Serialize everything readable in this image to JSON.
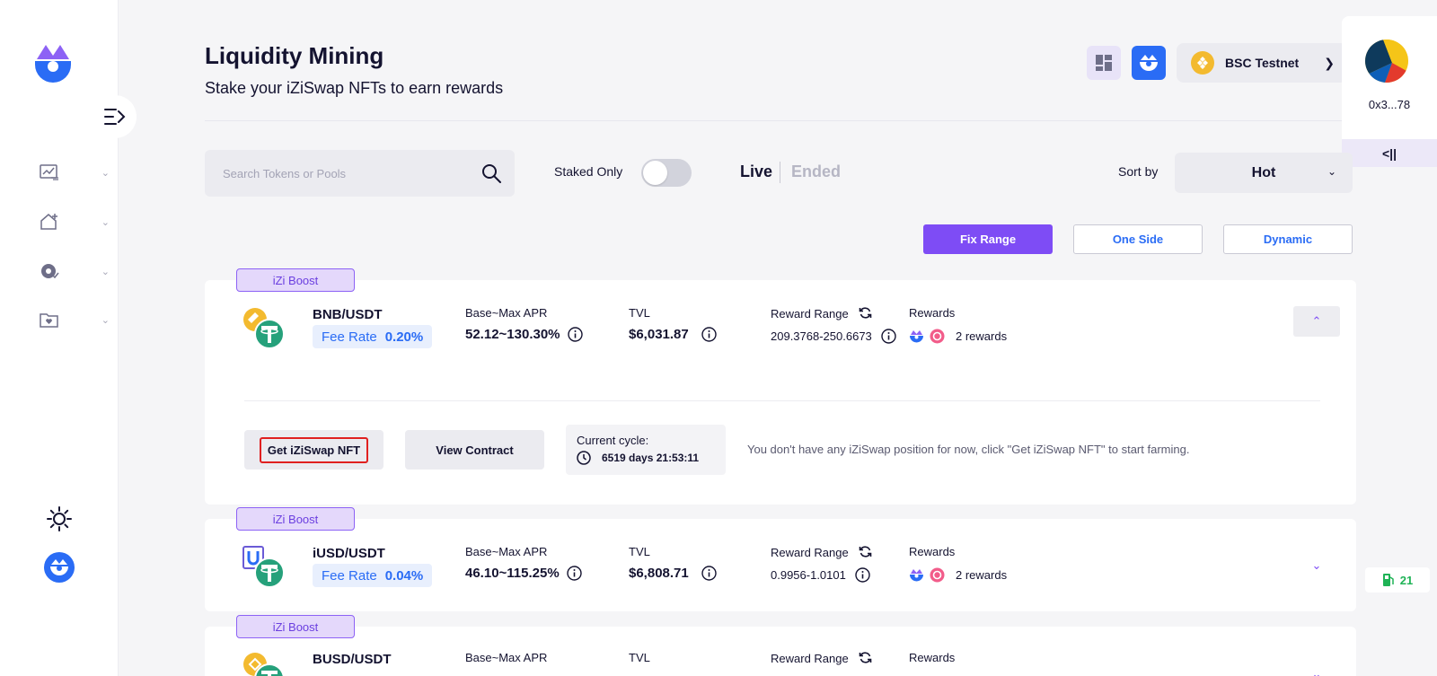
{
  "header": {
    "title": "Liquidity Mining",
    "subtitle": "Stake your iZiSwap NFTs to earn rewards"
  },
  "topbar": {
    "network_label": "BSC Testnet"
  },
  "account": {
    "address": "0x3...78",
    "panel_toggle": "<||"
  },
  "filters": {
    "search_placeholder": "Search Tokens or Pools",
    "staked_only_label": "Staked Only",
    "staked_only_on": false,
    "tab_live": "Live",
    "tab_ended": "Ended",
    "sort_label": "Sort by",
    "sort_value": "Hot"
  },
  "range_types": [
    {
      "label": "Fix Range",
      "active": true
    },
    {
      "label": "One Side",
      "active": false
    },
    {
      "label": "Dynamic",
      "active": false
    }
  ],
  "pools": [
    {
      "badge": "iZi Boost",
      "pair": "BNB/USDT",
      "fee_label": "Fee Rate",
      "fee_rate": "0.20%",
      "apr_label": "Base~Max APR",
      "apr": "52.12~130.30%",
      "tvl_label": "TVL",
      "tvl": "$6,031.87",
      "range_label": "Reward Range",
      "range": "209.3768-250.6673",
      "rewards_label": "Rewards",
      "rewards": "2 rewards",
      "expanded": true,
      "get_nft_label": "Get iZiSwap NFT",
      "view_contract_label": "View Contract",
      "cycle_label": "Current cycle:",
      "cycle_value": "6519 days 21:53:11",
      "message": "You don't have any iZiSwap position for now, click \"Get iZiSwap NFT\" to start farming."
    },
    {
      "badge": "iZi Boost",
      "pair": "iUSD/USDT",
      "fee_label": "Fee Rate",
      "fee_rate": "0.04%",
      "apr_label": "Base~Max APR",
      "apr": "46.10~115.25%",
      "tvl_label": "TVL",
      "tvl": "$6,808.71",
      "range_label": "Reward Range",
      "range": "0.9956-1.0101",
      "rewards_label": "Rewards",
      "rewards": "2 rewards",
      "expanded": false
    },
    {
      "badge": "iZi Boost",
      "pair": "BUSD/USDT",
      "apr_label": "Base~Max APR",
      "tvl_label": "TVL",
      "range_label": "Reward Range",
      "rewards_label": "Rewards",
      "expanded": false
    }
  ],
  "gas": {
    "value": "21"
  },
  "colors": {
    "accent_purple": "#7e4cf5",
    "accent_blue": "#2a6cf5",
    "badge_bg": "#e4d8fb",
    "gas_green": "#1fb356",
    "highlight_red": "#e02020"
  }
}
